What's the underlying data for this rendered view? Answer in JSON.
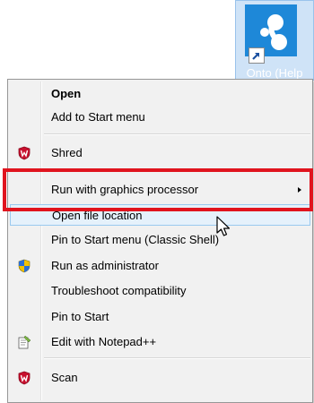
{
  "desktop": {
    "icon_label": "Onto (Help",
    "icon_name": "app-shortcut-icon"
  },
  "context_menu": {
    "items": [
      {
        "label": "Open",
        "bold": true
      },
      {
        "label": "Add to Start menu"
      },
      {
        "label": "Shred",
        "icon": "mcafee-shield-icon"
      },
      {
        "label": "Run with graphics processor",
        "has_submenu": true
      },
      {
        "label": "Open file location",
        "highlighted": true
      },
      {
        "label": "Pin to Start menu (Classic Shell)"
      },
      {
        "label": "Run as administrator",
        "icon": "uac-shield-icon"
      },
      {
        "label": "Troubleshoot compatibility"
      },
      {
        "label": "Pin to Start"
      },
      {
        "label": "Edit with Notepad++",
        "icon": "notepad-plus-plus-icon"
      },
      {
        "label": "Scan",
        "icon": "mcafee-shield-icon"
      }
    ]
  },
  "colors": {
    "menu_background": "#f1f1f1",
    "highlight_background": "#e5f1fb",
    "highlight_border": "#99c9ef",
    "annotation_red": "#e0141e",
    "app_tile_blue": "#1e88d8",
    "mcafee_red": "#c8102e"
  }
}
